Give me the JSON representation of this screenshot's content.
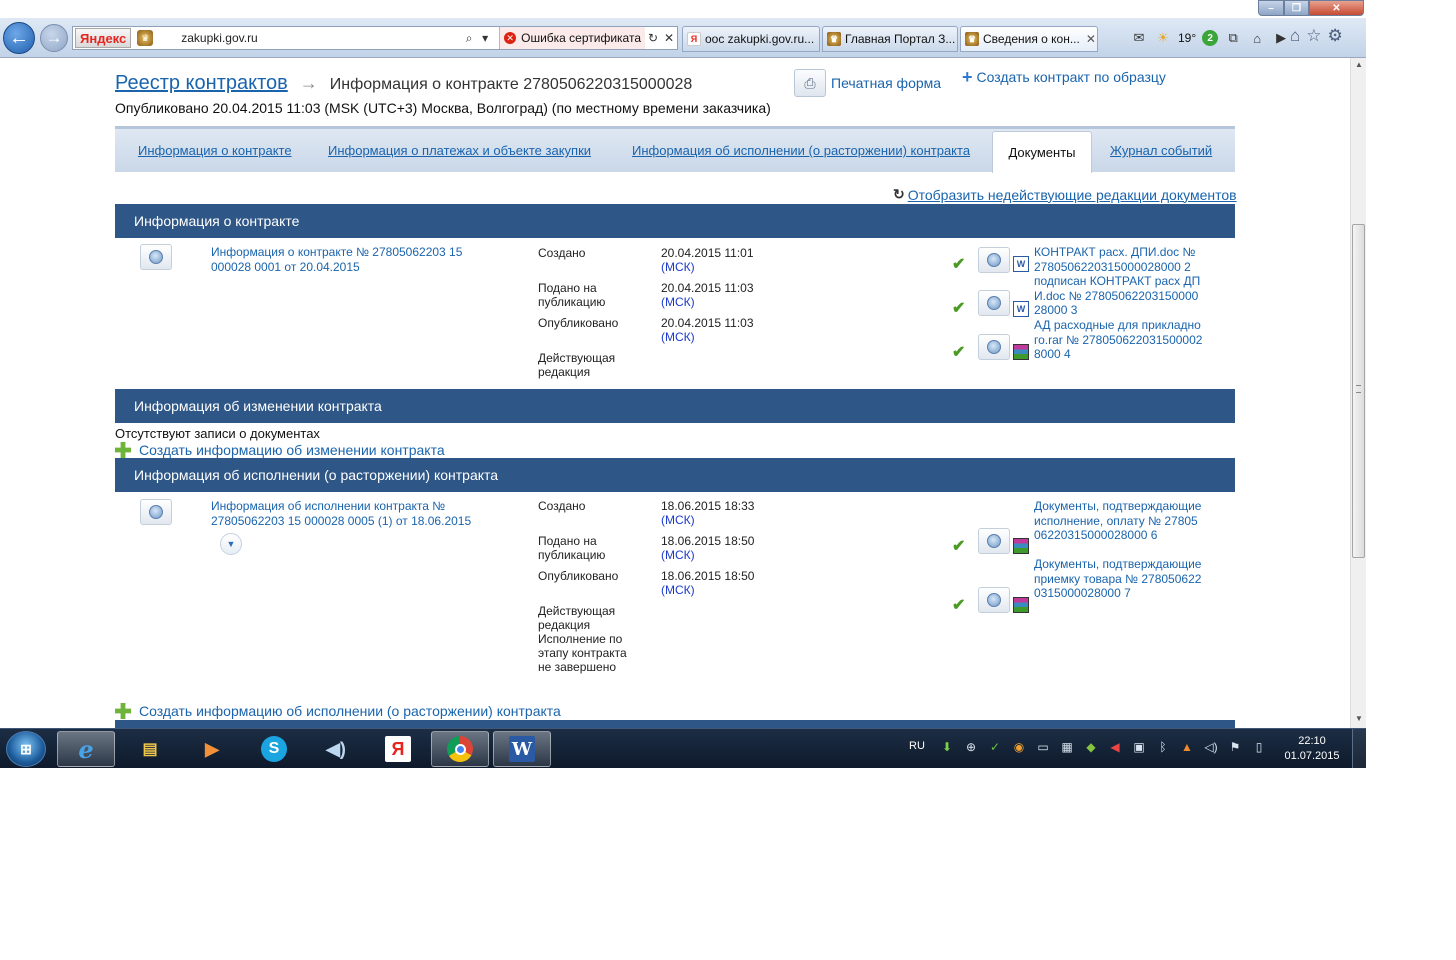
{
  "browser": {
    "search_logo": "Яндекс",
    "url": "zakupki.gov.ru",
    "cert_error": "Ошибка сертификата",
    "tabs": [
      {
        "label": "оос zakupki.gov.ru..."
      },
      {
        "label": "Главная Портал З..."
      },
      {
        "label": "Сведения о кон..."
      }
    ],
    "weather_temp": "19°",
    "notification_count": "2",
    "icons": [
      "back-arrow-icon",
      "forward-arrow-icon",
      "search-icon",
      "refresh-icon",
      "close-icon",
      "mail-icon",
      "weather-icon",
      "home-icon",
      "favorites-star-icon",
      "settings-gear-icon"
    ]
  },
  "page": {
    "breadcrumb_root": "Реестр контрактов",
    "breadcrumb_current": "Информация о контракте 2780506220315000028",
    "print_form": "Печатная форма",
    "create_by_sample": "Создать контракт по образцу",
    "published_line": "Опубликовано 20.04.2015 11:03 (MSK (UTC+3) Москва, Волгоград) (по местному времени заказчика)",
    "tabs": [
      {
        "label": "Информация о контракте"
      },
      {
        "label": "Информация о платежах и объекте закупки"
      },
      {
        "label": "Информация об исполнении (о расторжении) контракта"
      },
      {
        "label": "Документы",
        "active": true
      },
      {
        "label": "Журнал событий"
      }
    ],
    "show_inactive": "Отобразить недействующие редакции документов"
  },
  "sections": {
    "contract_info": {
      "title": "Информация о контракте",
      "doc_title": "Информация о контракте № 27805062203 15 000028 0001 от 20.04.2015",
      "meta": [
        {
          "label": "Создано",
          "value": "20.04.2015 11:01",
          "tz": "(МСК)"
        },
        {
          "label": "Подано на публикацию",
          "value": "20.04.2015 11:03",
          "tz": "(МСК)"
        },
        {
          "label": "Опубликовано",
          "value": "20.04.2015 11:03",
          "tz": "(МСК)"
        },
        {
          "label": "Действующая редакция"
        }
      ],
      "files": [
        {
          "name": "КОНТРАКТ расх. ДПИ.doc № 2780506220315000028000 2",
          "type": "doc"
        },
        {
          "name": "подписан КОНТРАКТ расх ДПИ.doc № 2780506220315000028000 3",
          "type": "doc"
        },
        {
          "name": "АД расходные для прикладного.rar № 2780506220315000028000 4",
          "type": "rar"
        }
      ]
    },
    "changes": {
      "title": "Информация об изменении контракта",
      "no_records": "Отсутствуют записи о документах",
      "create_link": "Создать информацию об изменении контракта"
    },
    "execution": {
      "title": "Информация об исполнении (о расторжении) контракта",
      "doc_title": "Информация об исполнении контракта № 27805062203 15 000028 0005 (1) от 18.06.2015",
      "meta": [
        {
          "label": "Создано",
          "value": "18.06.2015 18:33",
          "tz": "(МСК)"
        },
        {
          "label": "Подано на публикацию",
          "value": "18.06.2015 18:50",
          "tz": "(МСК)"
        },
        {
          "label": "Опубликовано",
          "value": "18.06.2015 18:50",
          "tz": "(МСК)"
        },
        {
          "label": "Действующая редакция Исполнение по этапу контракта не завершено"
        }
      ],
      "files": [
        {
          "name": "Документы, подтверждающие исполнение, оплату № 2780506220315000028000 6",
          "type": "rar"
        },
        {
          "name": "Документы, подтверждающие приемку товара № 2780506220315000028000 7",
          "type": "rar"
        }
      ],
      "create_link": "Создать информацию об исполнении (о расторжении) контракта"
    }
  },
  "taskbar": {
    "start": "⊞",
    "lang": "RU",
    "time": "22:10",
    "date": "01.07.2015",
    "apps": [
      "internet-explorer",
      "windows-explorer",
      "media-player",
      "skype",
      "sound-app",
      "yandex-browser",
      "chrome",
      "ms-word"
    ]
  }
}
